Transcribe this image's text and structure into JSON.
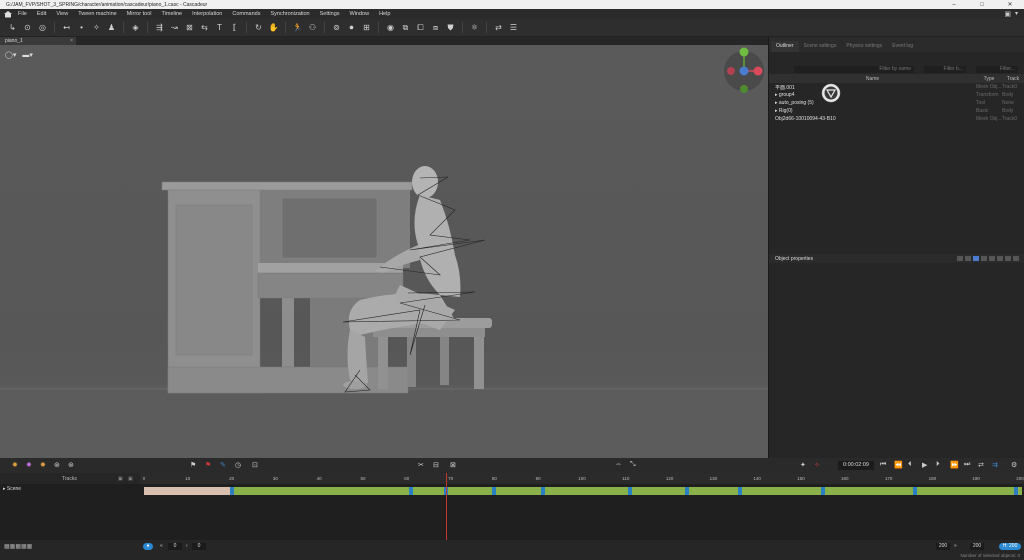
{
  "title_bar": {
    "text": "G:/JAM_FVP/SHOT_3_SPRING/character/animation/cascadeur/piano_1.casc - Cascadeur"
  },
  "menu": {
    "items": [
      "File",
      "Edit",
      "View",
      "Tween machine",
      "Mirror tool",
      "Timeline",
      "Interpolation",
      "Commands",
      "Synchronization",
      "Settings",
      "Window",
      "Help"
    ]
  },
  "viewport": {
    "tab_label": "piano_1"
  },
  "right_panel": {
    "tabs": [
      "Outliner",
      "Scene settings",
      "Physics settings",
      "Event log"
    ],
    "filter_by_name": "Filter by name",
    "filter_by": "Filter b...",
    "filter": "Filter...",
    "columns": {
      "name": "Name",
      "type": "Type",
      "track": "Track"
    },
    "rows": [
      {
        "name": "平面.001",
        "type": "Mesh Obj...",
        "track": "Track0"
      },
      {
        "name": "group4",
        "type": "Transform",
        "track": "Body"
      },
      {
        "name": "auto_posing (5)",
        "type": "Tool",
        "track": "None"
      },
      {
        "name": "Rig(0)",
        "type": "Basic",
        "track": "Body"
      },
      {
        "name": "Obj2d66-10010094-43-B10",
        "type": "Mesh Obj...",
        "track": "Track0"
      }
    ],
    "object_properties": "Object properties"
  },
  "controls": {
    "time": "0:00:02:09"
  },
  "timeline": {
    "tracks_label": "Tracks",
    "scene_label": "Scene",
    "ruler": [
      "0",
      "10",
      "20",
      "30",
      "40",
      "50",
      "60",
      "70",
      "80",
      "90",
      "100",
      "110",
      "120",
      "130",
      "140",
      "150",
      "160",
      "170",
      "180",
      "190",
      "200"
    ],
    "loop_end_frame": 20,
    "current_frame": 69,
    "key_frames": [
      20,
      61,
      69,
      80,
      91,
      111,
      124,
      136,
      155,
      176,
      200
    ]
  },
  "status": {
    "frame_start": "0",
    "frame_start2": "0",
    "range_start": "200",
    "range_end": "200",
    "total_frames": "200",
    "selection_info": "Number of selected objects: 0"
  },
  "colors": {
    "accent": "#2b8ad3",
    "key_green": "#8ab04a",
    "key_blue": "#2a7fc4",
    "loop": "#d9bfae",
    "playhead": "#c0392b"
  }
}
